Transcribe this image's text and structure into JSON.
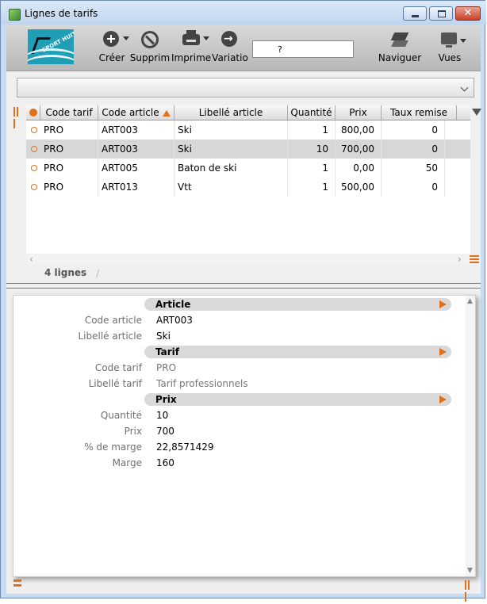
{
  "window": {
    "title": "Lignes de tarifs"
  },
  "logo": {
    "text": "SPORT HUIT"
  },
  "toolbar": {
    "buttons": [
      {
        "label": "Créer",
        "icon": "plus-circle-icon"
      },
      {
        "label": "Supprim",
        "icon": "ban-icon"
      },
      {
        "label": "Imprime",
        "icon": "printer-icon"
      },
      {
        "label": "Variatio",
        "icon": "variation-arrow-icon"
      },
      {
        "label": "Naviguer",
        "icon": "layers-icon"
      },
      {
        "label": "Vues",
        "icon": "monitor-icon"
      }
    ],
    "search": {
      "value": "?"
    }
  },
  "filter": {
    "value": ""
  },
  "grid": {
    "columns": [
      "Code tarif",
      "Code article",
      "Libellé article",
      "Quantité",
      "Prix",
      "Taux remise"
    ],
    "sorted_column": "Code article",
    "rows": [
      {
        "code_tarif": "PRO",
        "code_article": "ART003",
        "libelle": "Ski",
        "quantite": "1",
        "prix": "800,00",
        "taux": "0",
        "selected": false
      },
      {
        "code_tarif": "PRO",
        "code_article": "ART003",
        "libelle": "Ski",
        "quantite": "10",
        "prix": "700,00",
        "taux": "0",
        "selected": true
      },
      {
        "code_tarif": "PRO",
        "code_article": "ART005",
        "libelle": "Baton de ski",
        "quantite": "1",
        "prix": "0,00",
        "taux": "50",
        "selected": false
      },
      {
        "code_tarif": "PRO",
        "code_article": "ART013",
        "libelle": "Vtt",
        "quantite": "1",
        "prix": "500,00",
        "taux": "0",
        "selected": false
      }
    ],
    "count_label": "4 lignes"
  },
  "detail": {
    "sections": [
      {
        "title": "Article",
        "fields": [
          {
            "label": "Code article",
            "value": "ART003"
          },
          {
            "label": "Libellé article",
            "value": "Ski"
          }
        ]
      },
      {
        "title": "Tarif",
        "fields": [
          {
            "label": "Code tarif",
            "value": "PRO"
          },
          {
            "label": "Libellé tarif",
            "value": "Tarif professionnels"
          }
        ]
      },
      {
        "title": "Prix",
        "fields": [
          {
            "label": "Quantité",
            "value": "10"
          },
          {
            "label": "Prix",
            "value": "700"
          },
          {
            "label": "% de marge",
            "value": "22,8571429"
          },
          {
            "label": "Marge",
            "value": "160"
          }
        ]
      }
    ]
  },
  "colors": {
    "accent": "#e0701a",
    "selected_row": "#d7d7d7",
    "toolbar": "#c4c4c4"
  }
}
